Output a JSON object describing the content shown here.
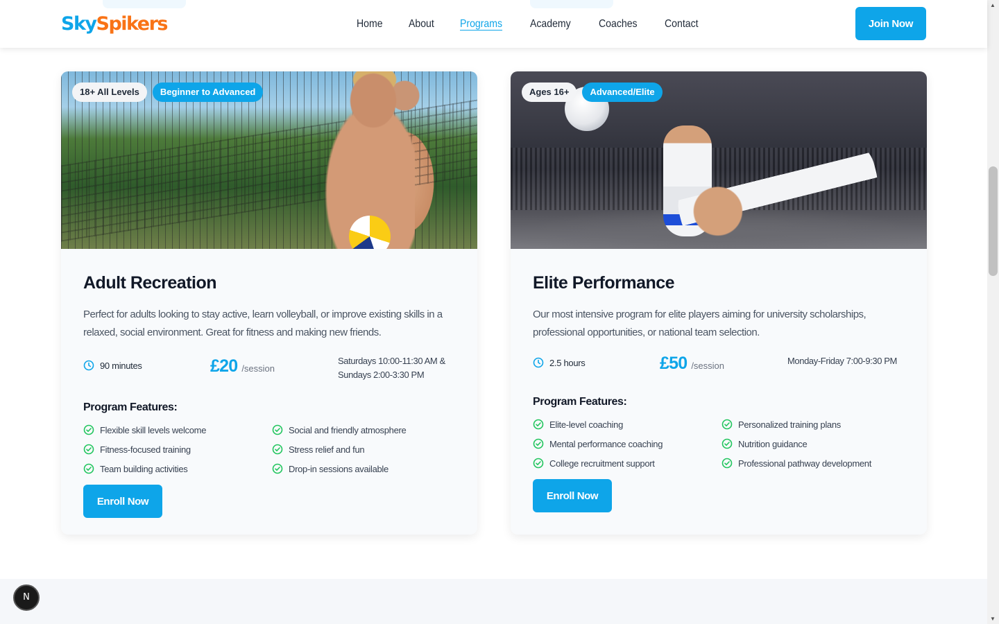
{
  "header": {
    "logo_part1": "Sky",
    "logo_part2": "Spikers",
    "nav": [
      "Home",
      "About",
      "Programs",
      "Academy",
      "Coaches",
      "Contact"
    ],
    "active_nav": "Programs",
    "join_label": "Join Now"
  },
  "programs": [
    {
      "badge_age": "18+ All Levels",
      "badge_level": "Beginner to Advanced",
      "title": "Adult Recreation",
      "description": "Perfect for adults looking to stay active, learn volleyball, or improve existing skills in a relaxed, social environment. Great for fitness and making new friends.",
      "duration": "90 minutes",
      "price": "£20",
      "price_unit": "/session",
      "schedule": "Saturdays 10:00-11:30 AM & Sundays 2:00-3:30 PM",
      "features_title": "Program Features:",
      "features": [
        "Flexible skill levels welcome",
        "Social and friendly atmosphere",
        "Fitness-focused training",
        "Stress relief and fun",
        "Team building activities",
        "Drop-in sessions available"
      ],
      "enroll_label": "Enroll Now"
    },
    {
      "badge_age": "Ages 16+",
      "badge_level": "Advanced/Elite",
      "title": "Elite Performance",
      "description": "Our most intensive program for elite players aiming for university scholarships, professional opportunities, or national team selection.",
      "duration": "2.5 hours",
      "price": "£50",
      "price_unit": "/session",
      "schedule": "Monday-Friday 7:00-9:30 PM",
      "features_title": "Program Features:",
      "features": [
        "Elite-level coaching",
        "Personalized training plans",
        "Mental performance coaching",
        "Nutrition guidance",
        "College recruitment support",
        "Professional pathway development"
      ],
      "enroll_label": "Enroll Now"
    }
  ],
  "dev_badge": "N",
  "colors": {
    "accent": "#0ea5e9",
    "logo_orange": "#f97316",
    "check_green": "#22c55e",
    "card_bg": "#f8fafc"
  },
  "icons": {
    "duration": "clock-icon",
    "feature": "check-circle-icon"
  }
}
